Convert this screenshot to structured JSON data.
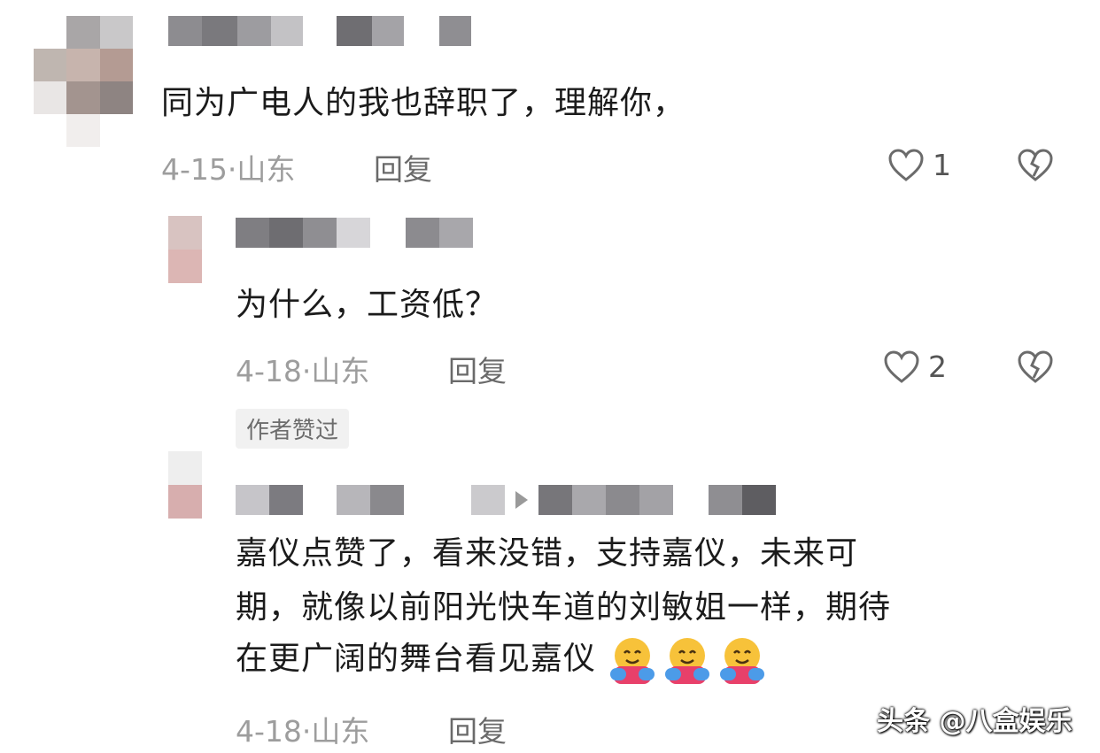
{
  "comments": [
    {
      "text": "同为广电人的我也辞职了，理解你，",
      "date": "4-15",
      "location": "山东",
      "reply_label": "回复",
      "like_count": "1"
    },
    {
      "text": "为什么，工资低？",
      "date": "4-18",
      "location": "山东",
      "reply_label": "回复",
      "like_count": "2",
      "badge": "作者赞过"
    },
    {
      "text_lines": [
        "嘉仪点赞了，看来没错，支持嘉仪，未来可",
        "期，就像以前阳光快车道的刘敏姐一样，期待",
        "在更广阔的舞台看见嘉仪"
      ],
      "date": "4-18",
      "location": "山东",
      "reply_label": "回复",
      "emojis": [
        "hugging-face",
        "hugging-face",
        "hugging-face"
      ]
    }
  ],
  "watermark": "头条 @八盒娱乐",
  "icons": {
    "like": "heart-outline-icon",
    "dislike": "broken-heart-icon"
  },
  "colors": {
    "text": "#1b1b1b",
    "meta": "#9d9d9d",
    "reply": "#6a6a6a"
  }
}
